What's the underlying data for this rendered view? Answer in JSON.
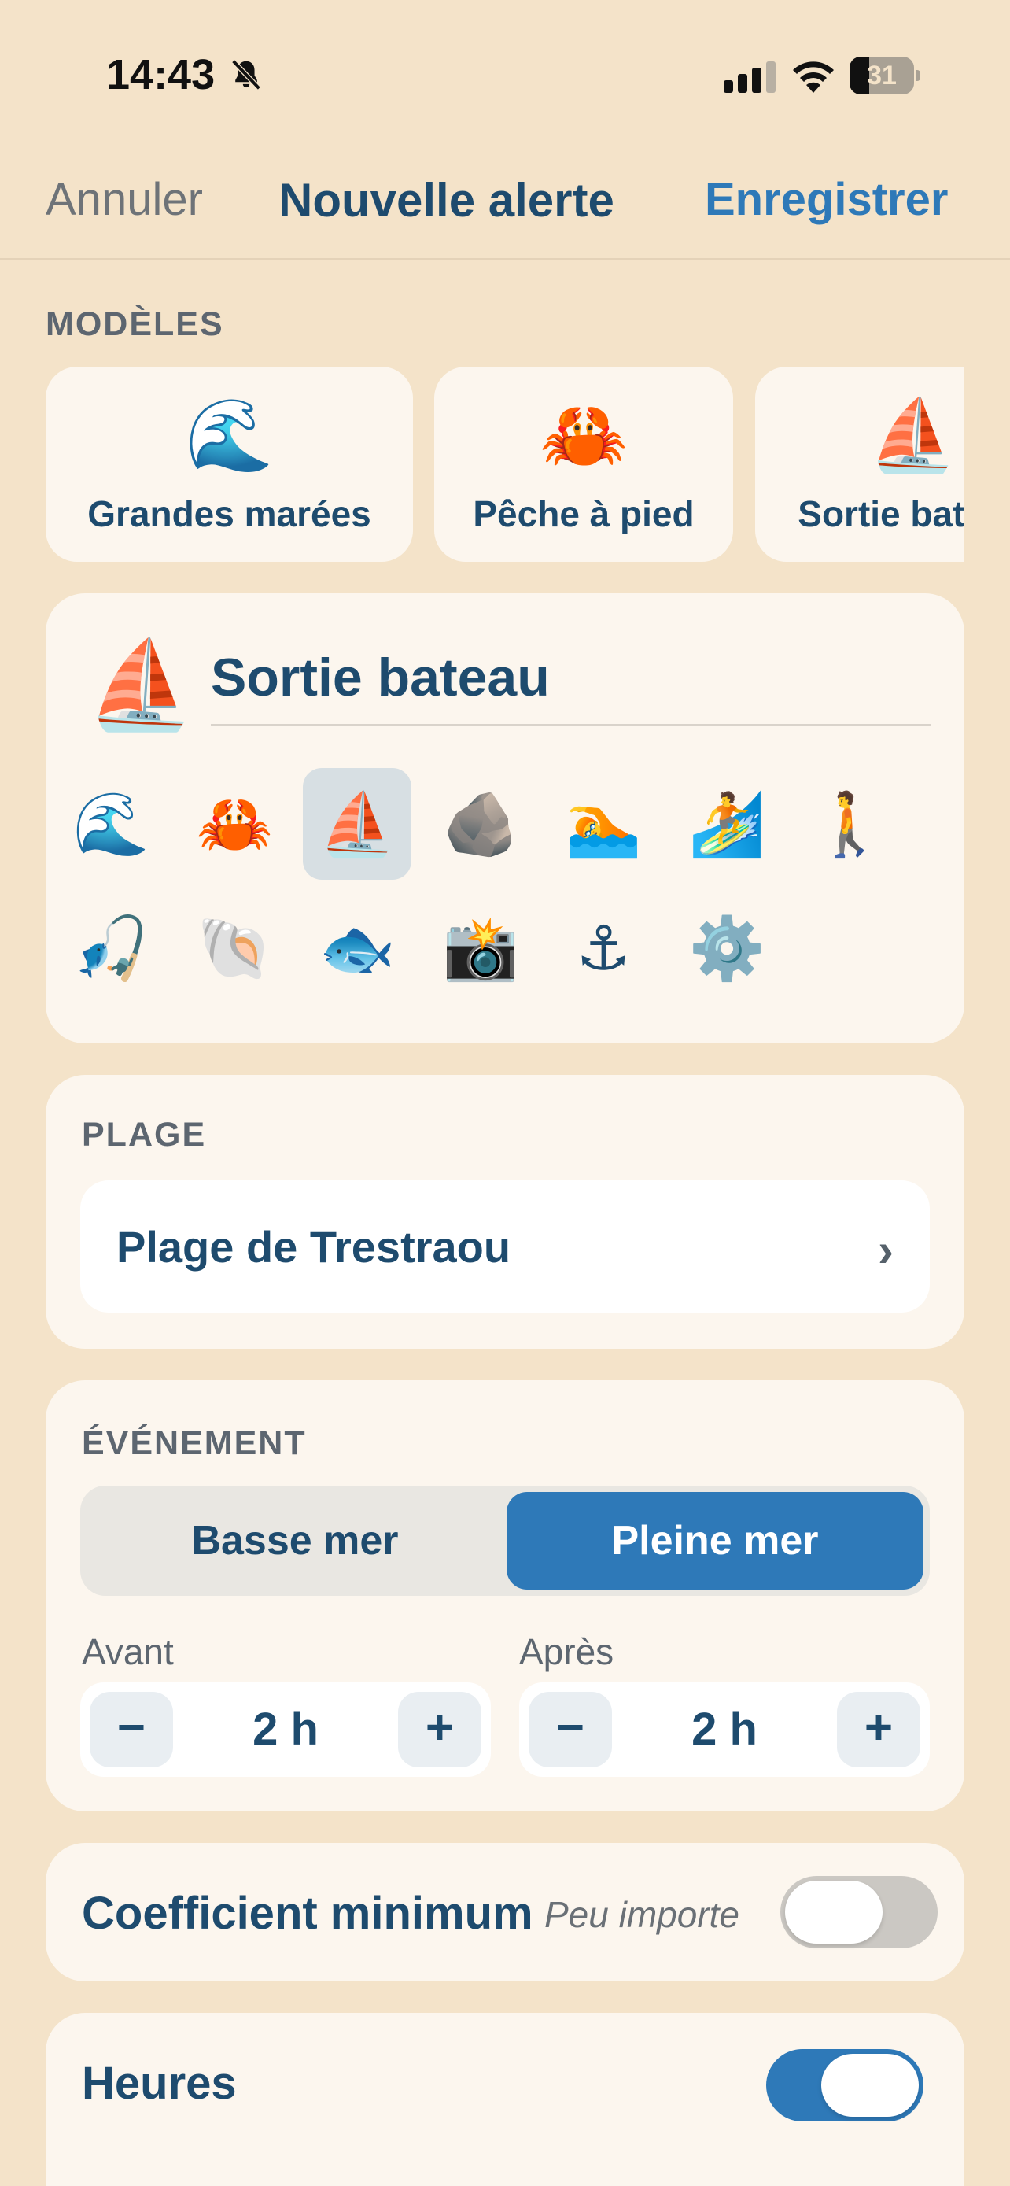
{
  "status_bar": {
    "time": "14:43",
    "battery_percent": "31",
    "battery_level": 0.31,
    "icons": [
      "bell-slash-icon",
      "cellular-signal-icon",
      "wifi-icon",
      "battery-icon"
    ]
  },
  "nav": {
    "cancel_label": "Annuler",
    "title": "Nouvelle alerte",
    "save_label": "Enregistrer"
  },
  "templates": {
    "section_label": "MODÈLES",
    "items": [
      {
        "emoji": "🌊",
        "label": "Grandes marées"
      },
      {
        "emoji": "🦀",
        "label": "Pêche à pied"
      },
      {
        "emoji": "⛵",
        "label": "Sortie bateau"
      }
    ]
  },
  "alert_name": {
    "emoji": "⛵",
    "value": "Sortie bateau",
    "icons": [
      {
        "emoji": "🌊",
        "name": "wave-icon",
        "selected": false
      },
      {
        "emoji": "🦀",
        "name": "crab-icon",
        "selected": false
      },
      {
        "emoji": "⛵",
        "name": "sailboat-icon",
        "selected": true
      },
      {
        "emoji": "🪨",
        "name": "rock-icon",
        "selected": false
      },
      {
        "emoji": "🏊",
        "name": "swimmer-icon",
        "selected": false
      },
      {
        "emoji": "🏄",
        "name": "surfer-icon",
        "selected": false
      },
      {
        "emoji": "🚶",
        "name": "walker-icon",
        "selected": false
      },
      {
        "emoji": "🎣",
        "name": "fishing-pole-icon",
        "selected": false
      },
      {
        "emoji": "🐚",
        "name": "shell-icon",
        "selected": false
      },
      {
        "emoji": "🐟",
        "name": "fish-icon",
        "selected": false
      },
      {
        "emoji": "📸",
        "name": "camera-icon",
        "selected": false
      },
      {
        "emoji": "⚓",
        "name": "anchor-icon",
        "selected": false
      },
      {
        "emoji": "⚙️",
        "name": "gear-icon",
        "selected": false
      }
    ]
  },
  "beach": {
    "section_label": "PLAGE",
    "value": "Plage de Trestraou",
    "chevron": "›"
  },
  "event": {
    "section_label": "ÉVÉNEMENT",
    "options": [
      "Basse mer",
      "Pleine mer"
    ],
    "selected": "Pleine mer",
    "before": {
      "label": "Avant",
      "value": "2 h",
      "minus": "−",
      "plus": "+"
    },
    "after": {
      "label": "Après",
      "value": "2 h",
      "minus": "−",
      "plus": "+"
    }
  },
  "coefficient": {
    "label": "Coefficient minimum",
    "hint": "Peu importe",
    "enabled": false
  },
  "hours": {
    "label": "Heures",
    "enabled": true
  },
  "colors": {
    "background": "#f4e3c9",
    "card": "#fcf6ee",
    "primary_text": "#1e4b6e",
    "accent": "#2e79b8",
    "toggle_off": "#cbc8c3"
  }
}
